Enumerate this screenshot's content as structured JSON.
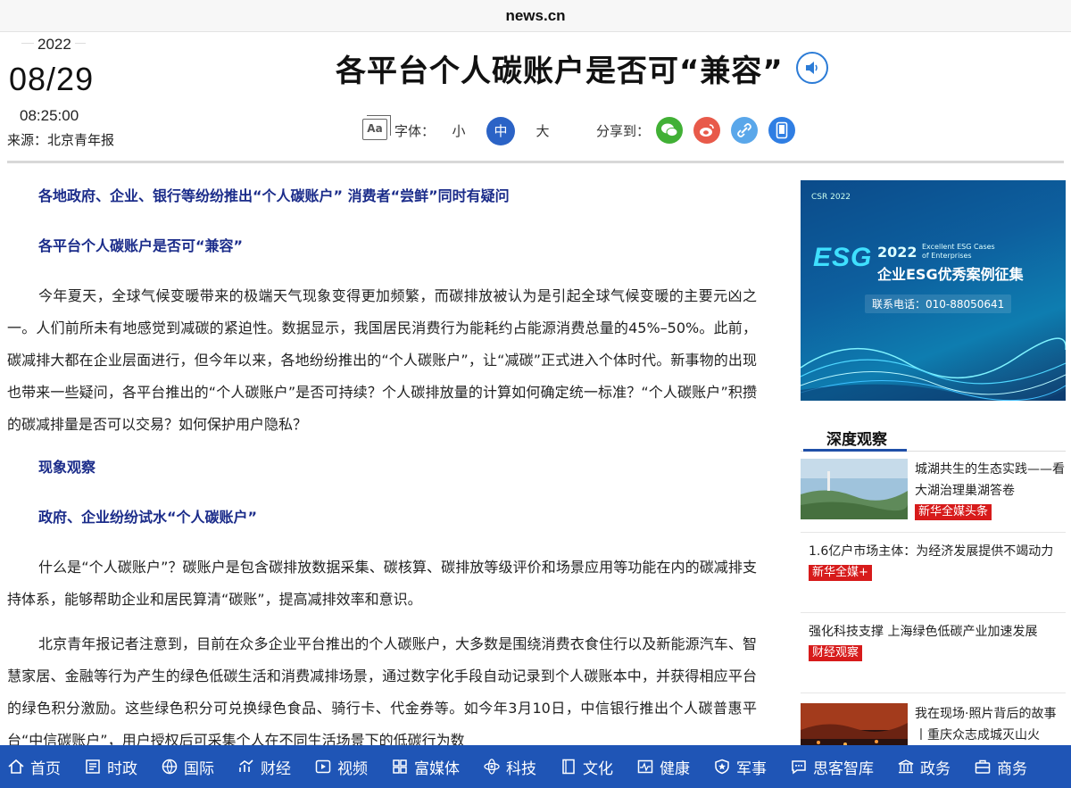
{
  "browser": {
    "url": "news.cn"
  },
  "date": {
    "year": "2022",
    "month_day": "08/29",
    "time": "08:25:00",
    "source": "来源：北京青年报"
  },
  "headline": "各平台个人碳账户是否可“兼容”",
  "tools": {
    "font_label": "字体：",
    "font_sizes": [
      "小",
      "中",
      "大"
    ],
    "share_label": "分享到：",
    "share_icons": [
      "wechat-icon",
      "weibo-icon",
      "link-icon",
      "mobile-icon"
    ]
  },
  "article": {
    "sub1": "各地政府、企业、银行等纷纷推出“个人碳账户” 消费者“尝鲜”同时有疑问",
    "sub2": "各平台个人碳账户是否可“兼容”",
    "p1": "今年夏天，全球气候变暖带来的极端天气现象变得更加频繁，而碳排放被认为是引起全球气候变暖的主要元凶之一。人们前所未有地感觉到减碳的紧迫性。数据显示，我国居民消费行为能耗约占能源消费总量的45%–50%。此前，碳减排大都在企业层面进行，但今年以来，各地纷纷推出的“个人碳账户”，让“减碳”正式进入个体时代。新事物的出现也带来一些疑问，各平台推出的“个人碳账户”是否可持续？个人碳排放量的计算如何确定统一标准？“个人碳账户”积攒的碳减排量是否可以交易？如何保护用户隐私？",
    "sub3": "现象观察",
    "sub4": "政府、企业纷纷试水“个人碳账户”",
    "p2": "什么是“个人碳账户”？碳账户是包含碳排放数据采集、碳核算、碳排放等级评价和场景应用等功能在内的碳减排支持体系，能够帮助企业和居民算清“碳账”，提高减排效率和意识。",
    "p3": "北京青年报记者注意到，目前在众多企业平台推出的个人碳账户，大多数是围绕消费衣食住行以及新能源汽车、智慧家居、金融等行为产生的绿色低碳生活和消费减排场景，通过数字化手段自动记录到个人碳账本中，并获得相应平台的绿色积分激励。这些绿色积分可兑换绿色食品、骑行卡、代金券等。如今年3月10日，中信银行推出个人碳普惠平台“中信碳账户”，用户授权后可采集个人在不同生活场景下的低碳行为数"
  },
  "ad": {
    "logo_text": "CSR 2022",
    "esg": "ESG",
    "year": "2022",
    "en": "Excellent ESG Cases of Enterprises",
    "title": "企业ESG优秀案例征集",
    "phone": "联系电话：010-88050641"
  },
  "sidebar": {
    "section_title": "深度观察",
    "items": [
      {
        "title": "城湖共生的生态实践——看大湖治理巢湖答卷",
        "tag": "新华全媒头条"
      },
      {
        "title": "1.6亿户市场主体：为经济发展提供不竭动力",
        "tag": "新华全媒+"
      },
      {
        "title": "强化科技支撑 上海绿色低碳产业加速发展",
        "tag": "财经观察"
      },
      {
        "title": "我在现场·照片背后的故事丨重庆众志成城灭山火",
        "tag": ""
      }
    ]
  },
  "nav": {
    "items": [
      {
        "label": "首页",
        "icon": "home-icon"
      },
      {
        "label": "时政",
        "icon": "politics-icon"
      },
      {
        "label": "国际",
        "icon": "globe-icon"
      },
      {
        "label": "财经",
        "icon": "finance-icon"
      },
      {
        "label": "视频",
        "icon": "video-icon"
      },
      {
        "label": "富媒体",
        "icon": "media-icon"
      },
      {
        "label": "科技",
        "icon": "tech-icon"
      },
      {
        "label": "文化",
        "icon": "culture-icon"
      },
      {
        "label": "健康",
        "icon": "health-icon"
      },
      {
        "label": "军事",
        "icon": "military-icon"
      },
      {
        "label": "思客智库",
        "icon": "thinktank-icon"
      },
      {
        "label": "政务",
        "icon": "government-icon"
      },
      {
        "label": "商务",
        "icon": "business-icon"
      }
    ]
  }
}
